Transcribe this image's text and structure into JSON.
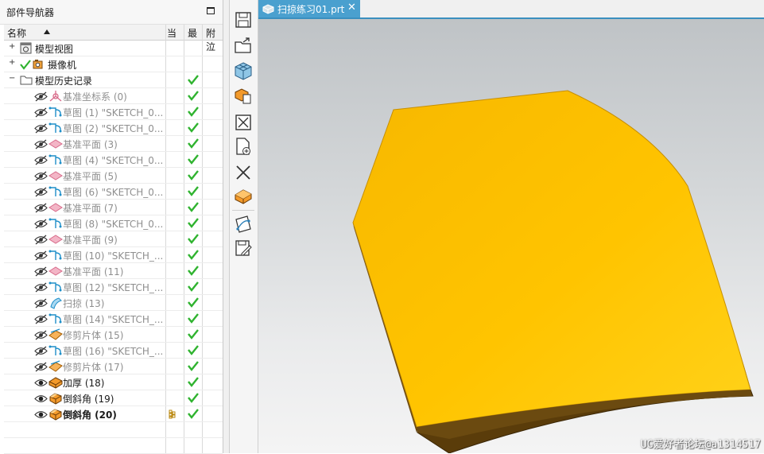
{
  "navigator": {
    "title": "部件导航器",
    "columns": {
      "name": "名称",
      "current": "当",
      "latest": "最",
      "attached": "附泣"
    },
    "nodes": {
      "model_views": "模型视图",
      "cameras": "摄像机",
      "history": "模型历史记录"
    },
    "features": [
      {
        "label": "基准坐标系 (0)",
        "icon": "datum-csys-icon",
        "suppressed": true
      },
      {
        "label": "草图 (1) \"SKETCH_0...",
        "icon": "sketch-icon",
        "suppressed": true
      },
      {
        "label": "草图 (2) \"SKETCH_0...",
        "icon": "sketch-icon",
        "suppressed": true
      },
      {
        "label": "基准平面 (3)",
        "icon": "datum-plane-icon",
        "suppressed": true
      },
      {
        "label": "草图 (4) \"SKETCH_0...",
        "icon": "sketch-icon",
        "suppressed": true
      },
      {
        "label": "基准平面 (5)",
        "icon": "datum-plane-icon",
        "suppressed": true
      },
      {
        "label": "草图 (6) \"SKETCH_0...",
        "icon": "sketch-icon",
        "suppressed": true
      },
      {
        "label": "基准平面 (7)",
        "icon": "datum-plane-icon",
        "suppressed": true
      },
      {
        "label": "草图 (8) \"SKETCH_0...",
        "icon": "sketch-icon",
        "suppressed": true
      },
      {
        "label": "基准平面 (9)",
        "icon": "datum-plane-icon",
        "suppressed": true
      },
      {
        "label": "草图 (10) \"SKETCH_...",
        "icon": "sketch-icon",
        "suppressed": true
      },
      {
        "label": "基准平面 (11)",
        "icon": "datum-plane-icon",
        "suppressed": true
      },
      {
        "label": "草图 (12) \"SKETCH_...",
        "icon": "sketch-icon",
        "suppressed": true
      },
      {
        "label": "扫掠 (13)",
        "icon": "swept-icon",
        "suppressed": true
      },
      {
        "label": "草图 (14) \"SKETCH_...",
        "icon": "sketch-icon",
        "suppressed": true
      },
      {
        "label": "修剪片体 (15)",
        "icon": "trim-sheet-icon",
        "suppressed": true
      },
      {
        "label": "草图 (16) \"SKETCH_...",
        "icon": "sketch-icon",
        "suppressed": true
      },
      {
        "label": "修剪片体 (17)",
        "icon": "trim-sheet-icon",
        "suppressed": true
      },
      {
        "label": "加厚 (18)",
        "icon": "thicken-icon",
        "suppressed": false
      },
      {
        "label": "倒斜角 (19)",
        "icon": "chamfer-icon",
        "suppressed": false
      },
      {
        "label": "倒斜角 (20)",
        "icon": "chamfer-icon",
        "suppressed": false,
        "current": true
      }
    ]
  },
  "toolbar": {
    "items": [
      "save-icon",
      "export-icon",
      "view-cube-icon",
      "copy-body-icon",
      "close-box-icon",
      "new-part-icon",
      "delete-icon",
      "shaded-body-icon",
      "sketch-view-icon",
      "save-edit-icon"
    ]
  },
  "graphics": {
    "tab_label": "扫掠练习01.prt",
    "tab_close": "✕",
    "watermark": "UG爱好者论坛@a1314517",
    "part_color": "#F7B800"
  }
}
